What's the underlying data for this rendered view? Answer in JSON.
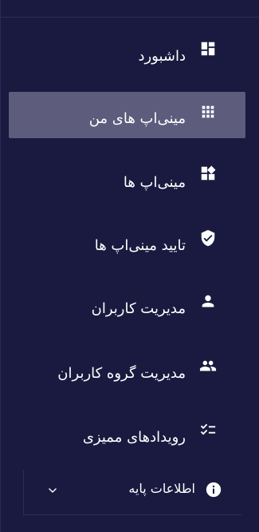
{
  "theme": {
    "background": "#1a1a40",
    "active_item_bg": "#5d5c7d",
    "text": "#ffffff"
  },
  "sidebar": {
    "items": [
      {
        "label": "داشبورد",
        "icon": "dashboard-icon",
        "active": false
      },
      {
        "label": "مینی‌اپ های من",
        "icon": "apps-grid-icon",
        "active": true
      },
      {
        "label": "مینی‌اپ ها",
        "icon": "widgets-icon",
        "active": false
      },
      {
        "label": "تایید مینی‌اپ ها",
        "icon": "verified-shield-icon",
        "active": false
      },
      {
        "label": "مدیریت کاربران",
        "icon": "person-icon",
        "active": false
      },
      {
        "label": "مدیریت گروه کاربران",
        "icon": "group-icon",
        "active": false
      },
      {
        "label": "رویدادهای ممیزی",
        "icon": "checklist-icon",
        "active": false
      }
    ],
    "group": {
      "label": "اطلاعات پایه",
      "icon": "info-icon",
      "expander_icon": "chevron-down-icon",
      "expanded": false
    }
  }
}
